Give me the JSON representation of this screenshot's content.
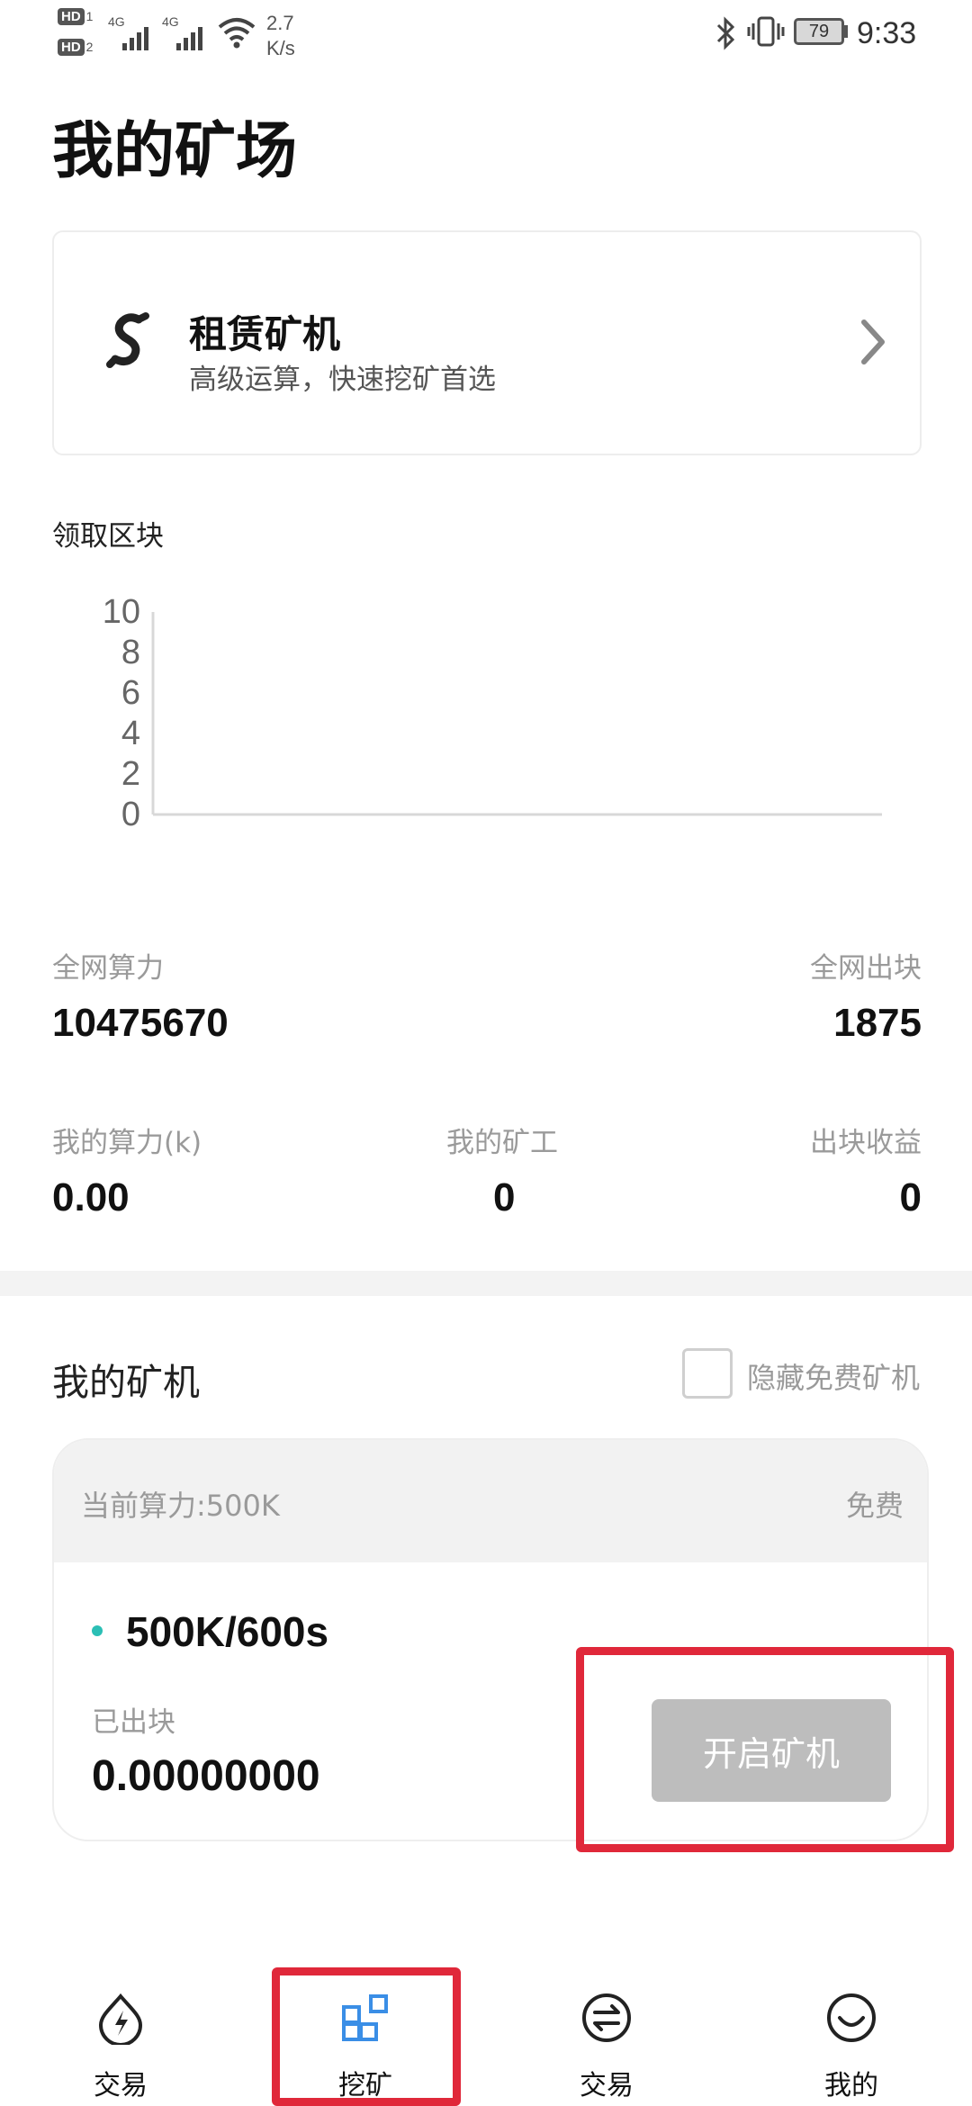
{
  "status_bar": {
    "hd1": "HD",
    "hd1_num": "1",
    "hd2": "HD",
    "hd2_num": "2",
    "signal1": "4G",
    "signal2": "4G",
    "speed_value": "2.7",
    "speed_unit": "K/s",
    "battery": "79",
    "time": "9:33"
  },
  "page": {
    "title": "我的矿场"
  },
  "rent_card": {
    "title": "租赁矿机",
    "subtitle": "高级运算，快速挖矿首选"
  },
  "chart": {
    "label": "领取区块"
  },
  "chart_data": {
    "type": "line",
    "x": [],
    "series": [],
    "yticks": [
      "10",
      "8",
      "6",
      "4",
      "2",
      "0"
    ],
    "ylim": [
      0,
      10
    ]
  },
  "stats": {
    "network_power_label": "全网算力",
    "network_power_value": "10475670",
    "network_blocks_label": "全网出块",
    "network_blocks_value": "1875",
    "my_power_label": "我的算力(k)",
    "my_power_value": "0.00",
    "my_miners_label": "我的矿工",
    "my_miners_value": "0",
    "block_income_label": "出块收益",
    "block_income_value": "0"
  },
  "my_miners": {
    "title": "我的矿机",
    "hide_free_label": "隐藏免费矿机",
    "hide_free_checked": false,
    "card": {
      "current_power": "当前算力:500K",
      "price_tag": "免费",
      "rate": "500K/600s",
      "mined_label": "已出块",
      "mined_value": "0.00000000",
      "start_button": "开启矿机"
    }
  },
  "bottom_nav": {
    "items": [
      {
        "label": "交易",
        "icon": "lightning-circle-icon"
      },
      {
        "label": "挖矿",
        "icon": "grid-blocks-icon",
        "active": true
      },
      {
        "label": "交易",
        "icon": "exchange-arrows-icon"
      },
      {
        "label": "我的",
        "icon": "smile-face-icon"
      }
    ]
  },
  "colors": {
    "accent_blue": "#3a8ee6",
    "teal_dot": "#2bbfb5",
    "highlight_red": "#e0283a",
    "button_disabled": "#bdbdbd"
  }
}
